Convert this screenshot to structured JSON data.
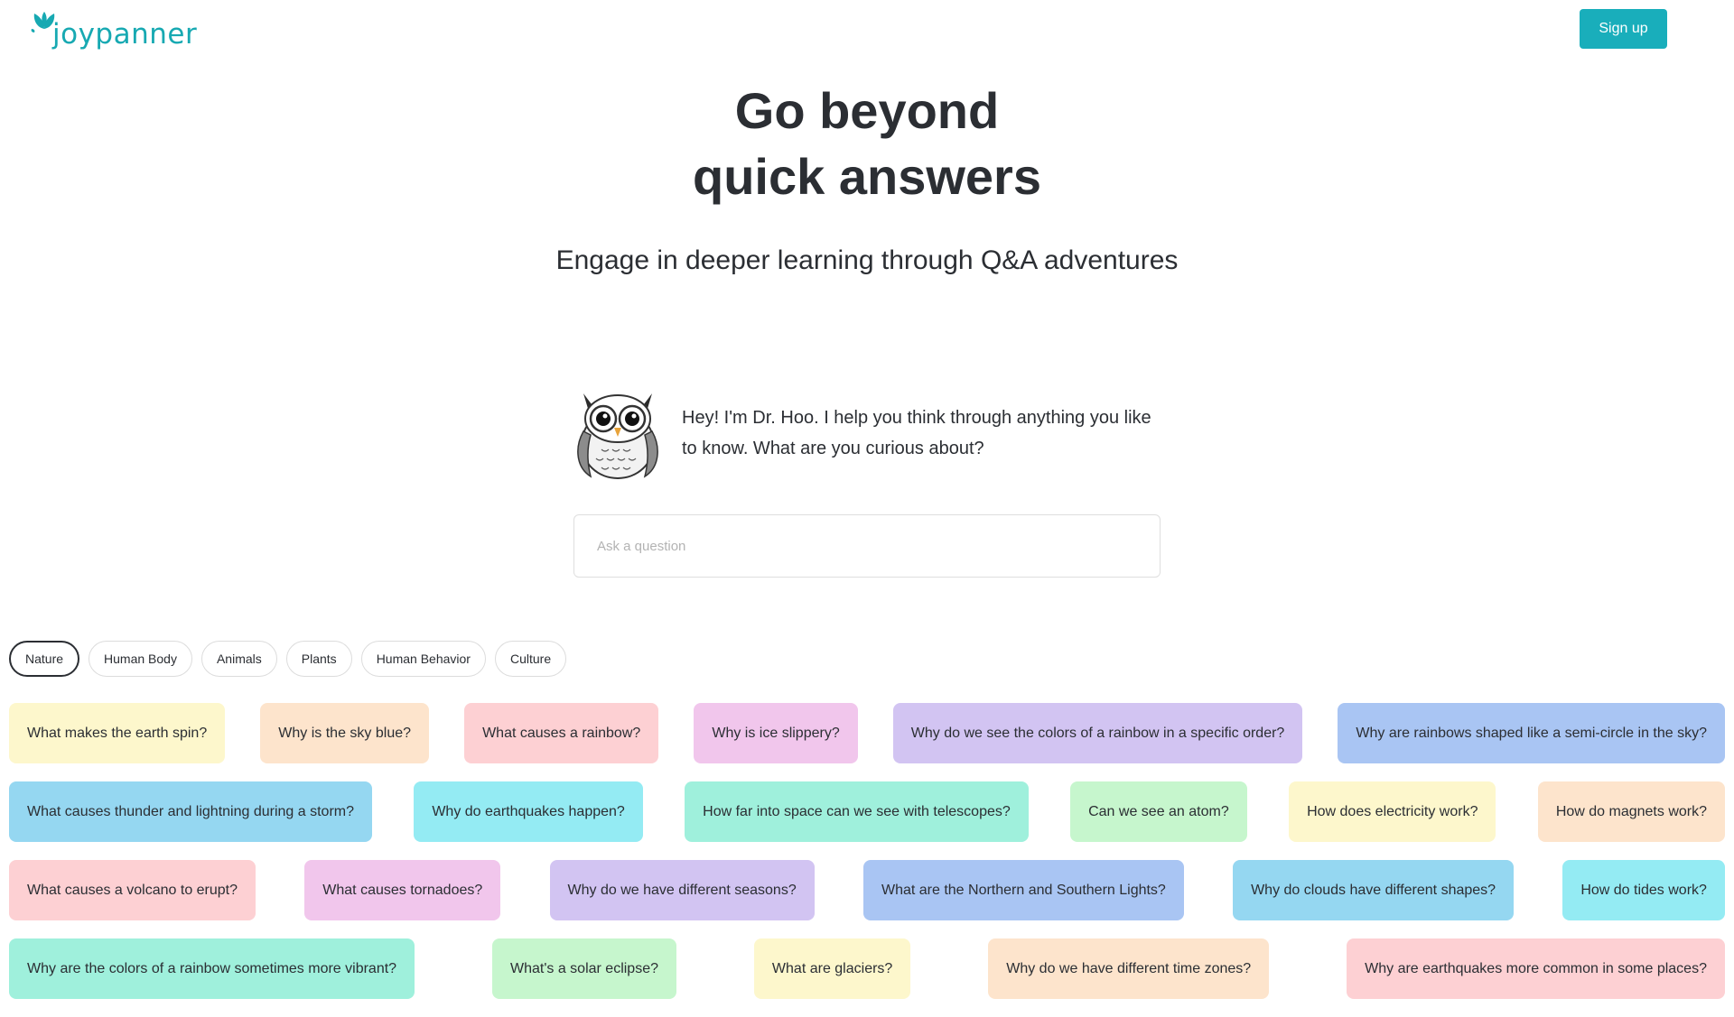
{
  "header": {
    "logo_text": "joypanner",
    "signup_label": "Sign up",
    "brand_color": "#17a9b2"
  },
  "hero": {
    "title_line1": "Go beyond",
    "title_line2": "quick answers",
    "subtitle": "Engage in deeper learning through Q&A adventures"
  },
  "assistant": {
    "avatar_icon": "owl-icon",
    "greeting": "Hey! I'm Dr. Hoo. I help you think through anything you like to know. What are you curious about?"
  },
  "search": {
    "placeholder": "Ask a question",
    "value": ""
  },
  "categories": {
    "items": [
      {
        "label": "Nature",
        "active": true
      },
      {
        "label": "Human Body",
        "active": false
      },
      {
        "label": "Animals",
        "active": false
      },
      {
        "label": "Plants",
        "active": false
      },
      {
        "label": "Human Behavior",
        "active": false
      },
      {
        "label": "Culture",
        "active": false
      }
    ]
  },
  "questions": {
    "rows": [
      [
        {
          "text": "What makes the earth spin?",
          "color": "#fdf7cc"
        },
        {
          "text": "Why is the sky blue?",
          "color": "#fde4cc"
        },
        {
          "text": "What causes a rainbow?",
          "color": "#fdd0d3"
        },
        {
          "text": "Why is ice slippery?",
          "color": "#f1c6ec"
        },
        {
          "text": "Why do we see the colors of a rainbow in a specific order?",
          "color": "#d2c4f2"
        },
        {
          "text": "Why are rainbows shaped like a semi-circle in the sky?",
          "color": "#a9c5f3"
        }
      ],
      [
        {
          "text": "What causes thunder and lightning during a storm?",
          "color": "#95d7f1"
        },
        {
          "text": "Why do earthquakes happen?",
          "color": "#94ebf3"
        },
        {
          "text": "How far into space can we see with telescopes?",
          "color": "#9ff0dc"
        },
        {
          "text": "Can we see an atom?",
          "color": "#c6f6cd"
        },
        {
          "text": "How does electricity work?",
          "color": "#fdf7cc"
        },
        {
          "text": "How do magnets work?",
          "color": "#fde4cc"
        }
      ],
      [
        {
          "text": "What causes a volcano to erupt?",
          "color": "#fdd0d3"
        },
        {
          "text": "What causes tornadoes?",
          "color": "#f1c6ec"
        },
        {
          "text": "Why do we have different seasons?",
          "color": "#d2c4f2"
        },
        {
          "text": "What are the Northern and Southern Lights?",
          "color": "#a9c5f3"
        },
        {
          "text": "Why do clouds have different shapes?",
          "color": "#95d7f1"
        },
        {
          "text": "How do tides work?",
          "color": "#94ebf3"
        }
      ],
      [
        {
          "text": "Why are the colors of a rainbow sometimes more vibrant?",
          "color": "#9ff0dc"
        },
        {
          "text": "What's a solar eclipse?",
          "color": "#c6f6cd"
        },
        {
          "text": "What are glaciers?",
          "color": "#fdf7cc"
        },
        {
          "text": "Why do we have different time zones?",
          "color": "#fde4cc"
        },
        {
          "text": "Why are earthquakes more common in some places?",
          "color": "#fdd0d3"
        }
      ]
    ]
  }
}
